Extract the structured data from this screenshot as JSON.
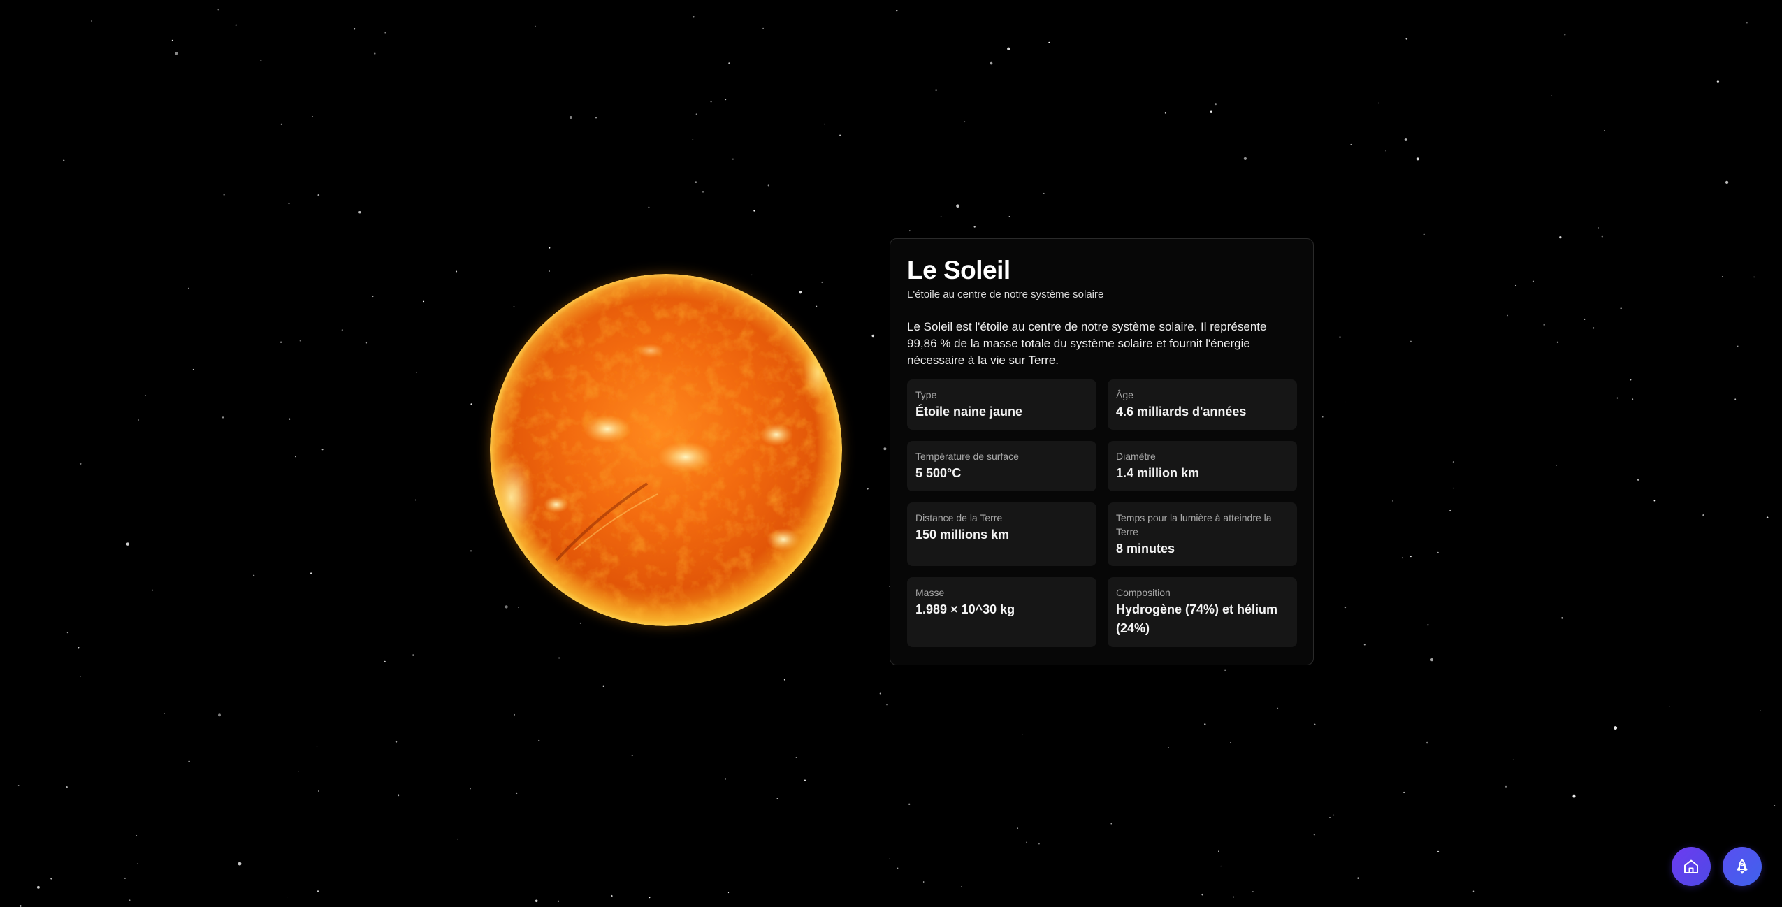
{
  "planet": {
    "title": "Le Soleil",
    "subtitle": "L'étoile au centre de notre système solaire",
    "description": "Le Soleil est l'étoile au centre de notre système solaire. Il représente 99,86 % de la masse totale du système solaire et fournit l'énergie nécessaire à la vie sur Terre.",
    "facts": [
      {
        "label": "Type",
        "value": "Étoile naine jaune"
      },
      {
        "label": "Âge",
        "value": "4.6 milliards d'années"
      },
      {
        "label": "Température de surface",
        "value": "5 500°C"
      },
      {
        "label": "Diamètre",
        "value": "1.4 million km"
      },
      {
        "label": "Distance de la Terre",
        "value": "150 millions km"
      },
      {
        "label": "Temps pour la lumière à atteindre la Terre",
        "value": "8 minutes"
      },
      {
        "label": "Masse",
        "value": "1.989 × 10^30 kg"
      },
      {
        "label": "Composition",
        "value": "Hydrogène (74%) et hélium (24%)"
      }
    ]
  },
  "nav": {
    "home_icon": "home-icon",
    "rocket_icon": "rocket-icon"
  },
  "colors": {
    "background": "#000000",
    "panel": "#070707",
    "card": "#161616",
    "accent_gradient_start": "#6d3bf0",
    "accent_gradient_end": "#3f62ec"
  }
}
